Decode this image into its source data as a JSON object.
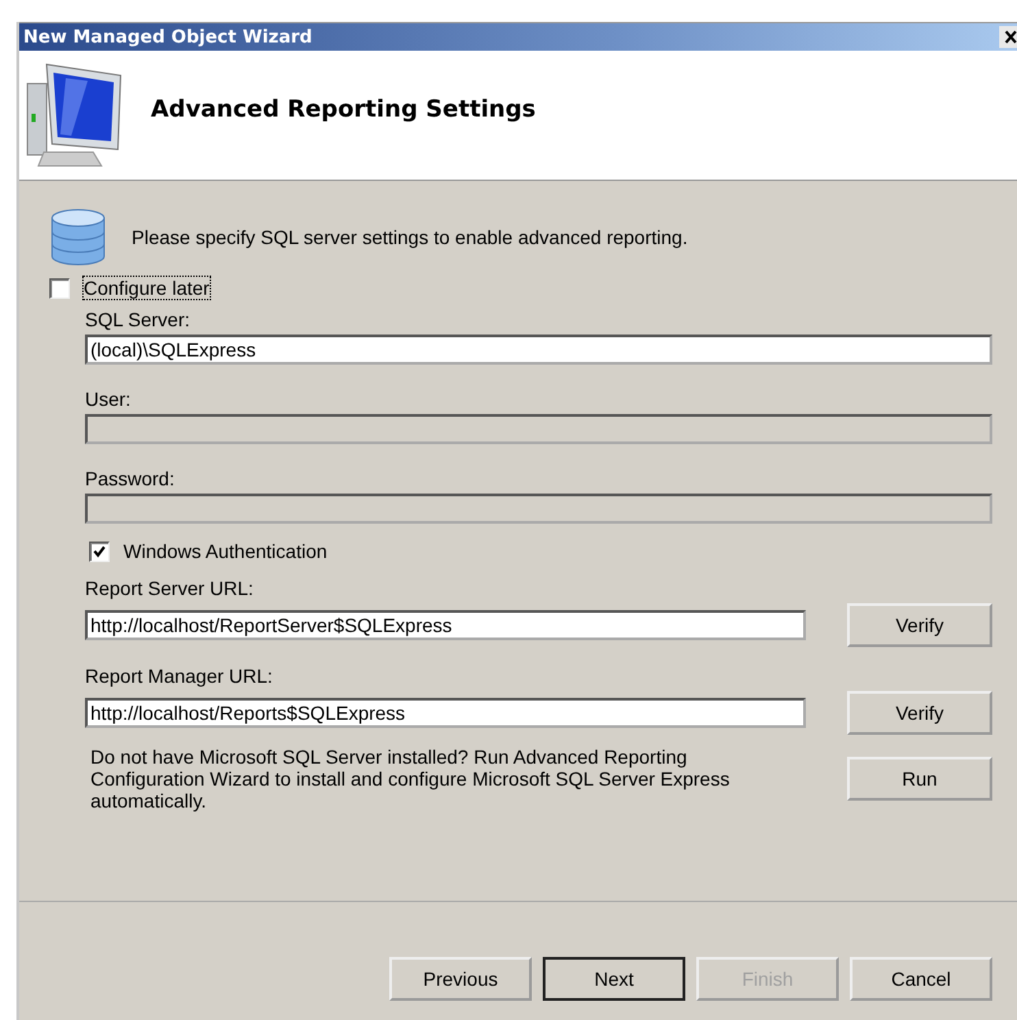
{
  "window": {
    "title": "New Managed Object Wizard"
  },
  "header": {
    "title": "Advanced Reporting Settings"
  },
  "intro": "Please specify SQL server settings to enable advanced reporting.",
  "configure_later": {
    "label": "Configure later",
    "checked": false
  },
  "fields": [
    {
      "label": "SQL Server:",
      "value": "(local)\\SQLExpress",
      "disabled": false
    },
    {
      "label": "User:",
      "disabled": true
    },
    {
      "label": "Password:",
      "disabled": true
    }
  ],
  "windows_auth": {
    "label": "Windows Authentication",
    "checked": true
  },
  "urls": [
    {
      "label": "Report Server URL:",
      "value": "http://localhost/ReportServer$SQLExpress",
      "button": "Verify"
    },
    {
      "label": "Report Manager URL:",
      "value": "http://localhost/Reports$SQLExpress",
      "button": "Verify"
    }
  ],
  "install_note": {
    "text": "Do not have Microsoft SQL Server installed? Run Advanced Reporting Configuration Wizard to install and configure Microsoft SQL Server Express automatically.",
    "button": "Run"
  },
  "buttons": [
    {
      "label": "Previous",
      "disabled": false,
      "default": false
    },
    {
      "label": "Next",
      "disabled": false,
      "default": true
    },
    {
      "label": "Finish",
      "disabled": true,
      "default": false
    },
    {
      "label": "Cancel",
      "disabled": false,
      "default": false
    }
  ]
}
